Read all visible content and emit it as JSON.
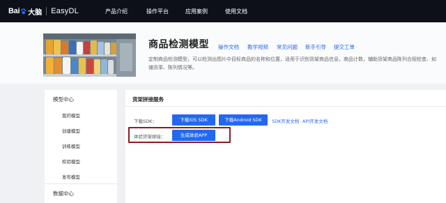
{
  "header": {
    "logo_text": "Bai",
    "logo_du": "大脑",
    "product_name": "EasyDL",
    "nav": [
      "产品介绍",
      "操作平台",
      "应用案例",
      "使用文档"
    ]
  },
  "hero": {
    "title": "商品检测模型",
    "links": [
      "操作文档",
      "教学视频",
      "常见问题",
      "新手引导",
      "提交工单"
    ],
    "description": "定制商品检测模型，可以检测出图片中目标商品的名称和位置，适用于识别货架商品信息，商品计数，辅助货架商品陈列合规检查、如铺货率、陈列情况等。"
  },
  "sidebar": {
    "group1": "模型中心",
    "items": [
      "我的模型",
      "创建模型",
      "训练模型",
      "校验模型",
      "发布模型"
    ],
    "group2": "数据中心"
  },
  "main": {
    "section_title": "货架拼接服务",
    "download_label": "下载SDK：",
    "ios_button": "下载iOS SDK",
    "android_button": "下载Android SDK",
    "sdk_doc_link": "SDK开发文档",
    "api_doc_link": "API开发文档",
    "experience_label": "体验货架拼接：",
    "generate_button": "生成体验APP"
  },
  "colors": {
    "topbar": "#0d1019",
    "accent": "#2468f2",
    "highlight_border": "#8b1c1f"
  }
}
